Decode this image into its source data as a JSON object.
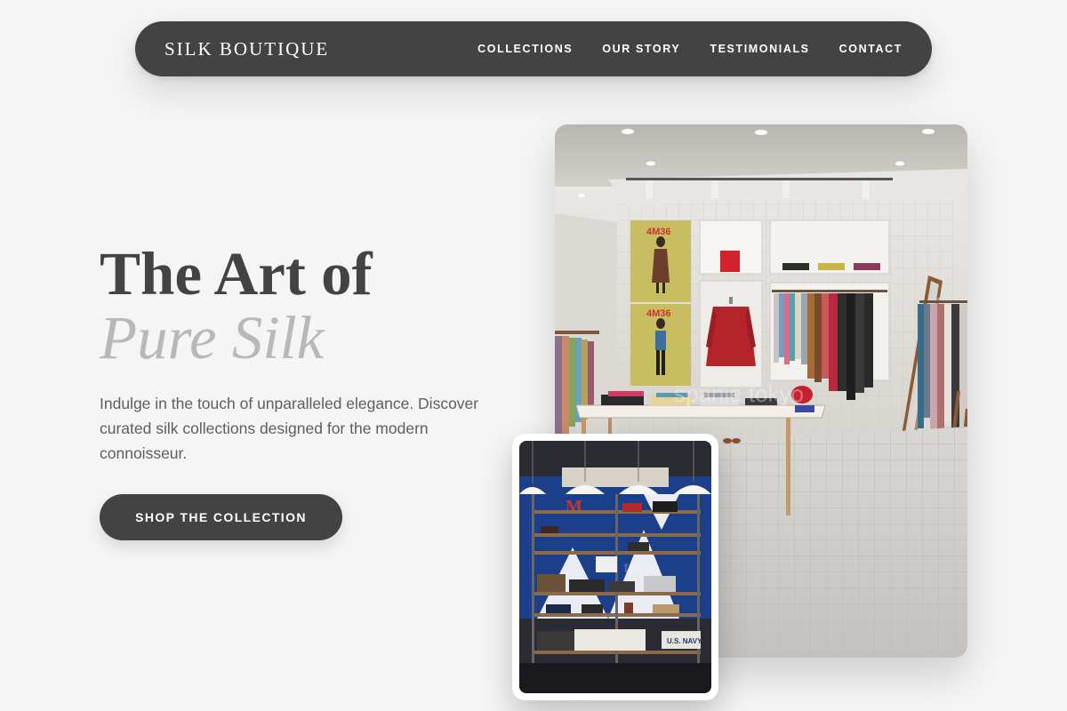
{
  "nav": {
    "brand": "SILK BOUTIQUE",
    "links": [
      "COLLECTIONS",
      "OUR STORY",
      "TESTIMONIALS",
      "CONTACT"
    ]
  },
  "hero": {
    "title_line1": "The Art of",
    "title_line2": "Pure Silk",
    "lead": "Indulge in the touch of unparalleled elegance. Discover curated silk collections designed for the modern connoisseur.",
    "cta_label": "SHOP THE COLLECTION"
  },
  "images": {
    "main": {
      "poster_text_1": "4M36",
      "poster_text_2": "4M36",
      "watermark": "spanie tokyo"
    },
    "secondary": {
      "sign_text": "M",
      "label_text": "U.S. NAVY",
      "watermark": "tokyo"
    }
  },
  "colors": {
    "nav_bg": "#434343",
    "button_bg": "#434343",
    "title_dark": "#434343",
    "title_light": "#b8b8b8",
    "body_text": "#5e5e5e",
    "page_bg": "#f5f5f5"
  }
}
